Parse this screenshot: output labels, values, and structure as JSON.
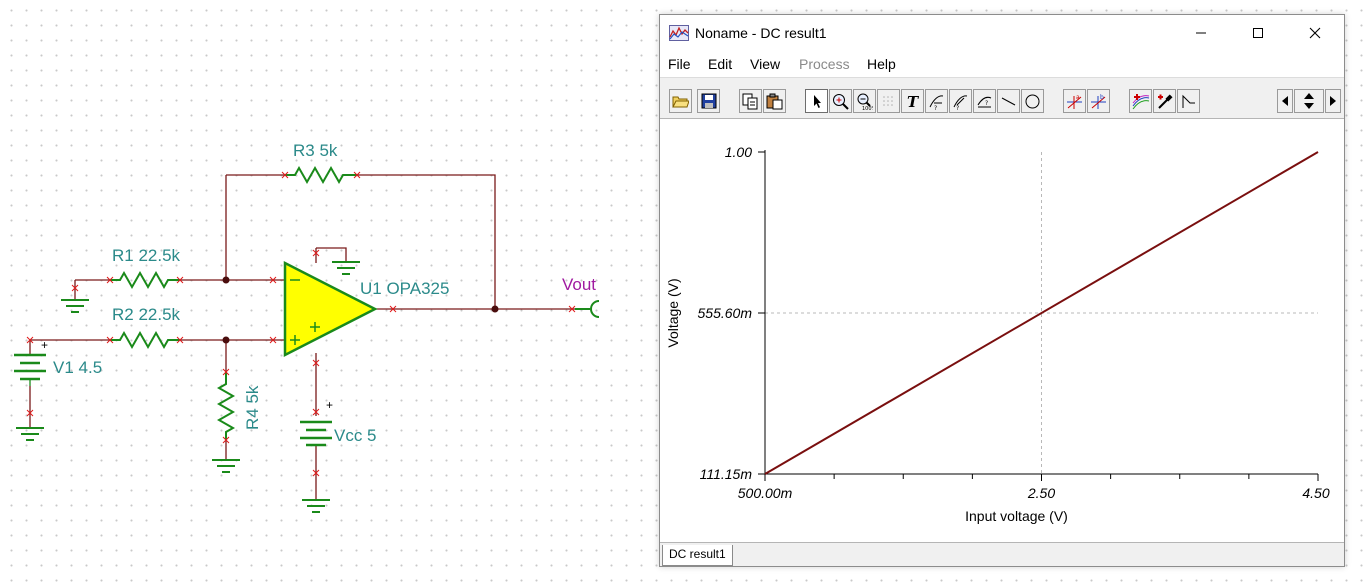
{
  "schematic": {
    "r3_label": "R3 5k",
    "r1_label": "R1 22.5k",
    "r2_label": "R2 22.5k",
    "u1_label": "U1 OPA325",
    "vout_label": "Vout",
    "v1_label": "V1 4.5",
    "r4_label": "R4 5k",
    "vcc_label": "Vcc 5",
    "colors": {
      "wire": "#7a1a1a",
      "label": "#2b8a8a",
      "component": "#1a8a1a",
      "opamp_fill": "#ffff00",
      "vout": "#a01aa0"
    }
  },
  "window": {
    "title": "Noname - DC result1",
    "menu": [
      "File",
      "Edit",
      "View",
      "Process",
      "Help"
    ],
    "menu_disabled": [
      "Process"
    ],
    "toolbar_icons": [
      "open-icon",
      "save-icon",
      "copy-icon",
      "paste-icon",
      "pointer-icon",
      "zoom-in-icon",
      "zoom-100-icon",
      "grid-icon",
      "text-icon",
      "label-curve-icon",
      "label-curve-2-icon",
      "label-axis-icon",
      "line-icon",
      "circle-icon",
      "cursor-a-icon",
      "cursor-b-icon",
      "curve-add-icon",
      "color-picker-icon",
      "waveform-icon",
      "scroll-left-icon",
      "scroll-updown-icon",
      "scroll-right-icon"
    ],
    "status_tab": "DC result1"
  },
  "chart_data": {
    "type": "line",
    "xlabel": "Input voltage (V)",
    "ylabel": "Voltage (V)",
    "xlim": [
      0.5,
      4.5
    ],
    "ylim": [
      0.11115,
      1.0
    ],
    "x_tick_labels": [
      "500.00m",
      "2.50",
      "4.50"
    ],
    "y_tick_labels": [
      "1.00",
      "555.60m",
      "111.15m"
    ],
    "grid": true,
    "line_color": "#7a0f0f",
    "series": [
      {
        "x": [
          0.5,
          4.5
        ],
        "y": [
          0.11115,
          1.0
        ]
      }
    ]
  }
}
